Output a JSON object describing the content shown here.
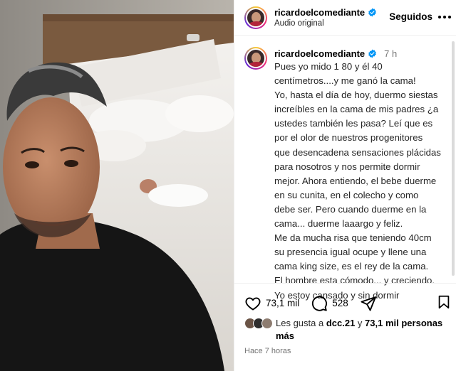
{
  "post": {
    "username": "ricardoelcomediante",
    "subtitle": "Audio original",
    "follow_label": "Seguidos",
    "timestamp_short": "7 h",
    "caption": "Pues yo mido 1 80 y él 40\ncentímetros....y me ganó la cama!\nYo, hasta el día de hoy, duermo siestas\nincreíbles en la cama de mis padres ¿a\nustedes también les pasa? Leí que es\npor el olor de nuestros progenitores\nque desencadena sensaciones plácidas\npara nosotros y nos permite dormir\nmejor. Ahora entiendo, el bebe duerme\nen su cunita, en el colecho y como\ndebe ser. Pero cuando duerme en la\ncama... duerme laaargo y feliz.\nMe da mucha risa que teniendo 40cm\nsu presencia igual ocupe y llene una\ncama king size, es el rey de la cama.\nEl hombre esta cómodo... y creciendo.\nYo estoy cansado y sin dormir",
    "time_ago": "Hace 7 horas"
  },
  "actions": {
    "like_icon": "heart-icon",
    "like_count": "73,1 mil",
    "comment_icon": "comment-icon",
    "comment_count": "528",
    "share_icon": "share-icon",
    "save_icon": "bookmark-icon"
  },
  "likes": {
    "prefix": "Les gusta a ",
    "first_user": "dcc.21",
    "connector": " y ",
    "others": "73,1 mil personas",
    "suffix": "más"
  },
  "colors": {
    "verified": "#0095f6",
    "muted": "#737373",
    "divider": "#efefef"
  }
}
